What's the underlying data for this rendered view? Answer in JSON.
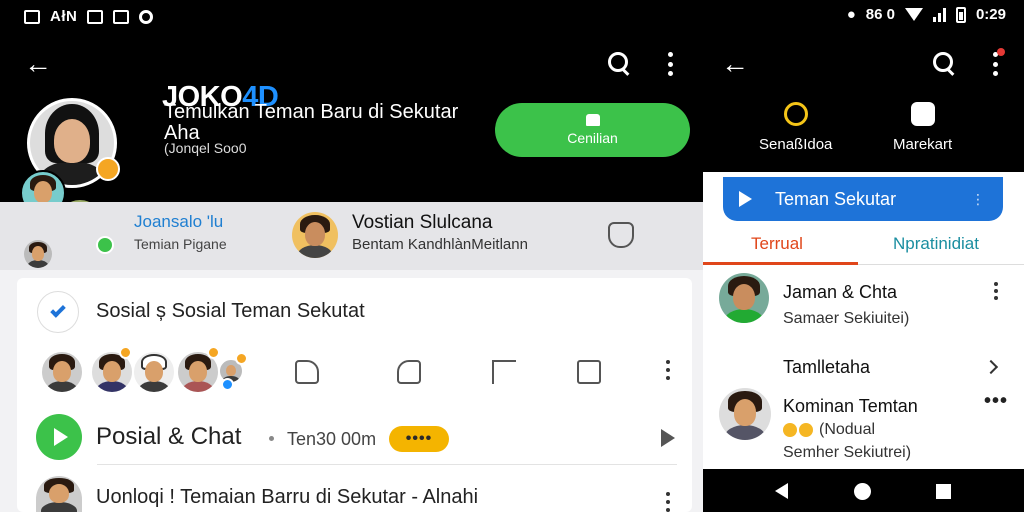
{
  "status_bar": {
    "left_text": "AłN",
    "time": "0:29",
    "right_codes": "86 0"
  },
  "header": {
    "brand_part1": "JOKO",
    "brand_part2": "4D",
    "profile_title": "Temulkan Teman Baru di Sekutar Aha",
    "profile_sub": "(Jonqel Soo0",
    "follow_label": "Cenilian"
  },
  "suggestions": [
    {
      "name": "Joansalo 'lu",
      "sub": "Temian Pigane"
    },
    {
      "name": "Vostian Slulcana",
      "sub": "Bentam KandhlànMeitlann"
    }
  ],
  "post1": {
    "title": "Sosial ș Sosial Teman Sekutat"
  },
  "post2": {
    "title": "Posial & Chat",
    "meta": "Ten30 00m",
    "pill": "••••"
  },
  "post3": {
    "title": "Uonloqi ! Temaian Barru di Sekutar - Alnahi"
  },
  "right_panel": {
    "quick_actions": [
      {
        "label": "SenaßIdoa",
        "icon": "sun-icon"
      },
      {
        "label": "Marekart",
        "icon": "user-card-icon"
      }
    ],
    "header_title": "Teman Sekutar",
    "header_more": "⋮",
    "tabs": [
      "Terrual",
      "Npratinidiat"
    ],
    "items": [
      {
        "name": "Jaman & Chta",
        "sub": "Samaer Sekiuitei)"
      },
      {
        "name": "Tamlletaha"
      },
      {
        "name": "Kominan Temtan",
        "sub": "(Nodual",
        "sub2": "Semher Sekiutrei)",
        "more": "•••"
      }
    ]
  },
  "colors": {
    "accent_blue": "#1e73d8",
    "follow_green": "#3cc24a",
    "tab_active": "#e0461a",
    "pill_yellow": "#f4b400"
  }
}
